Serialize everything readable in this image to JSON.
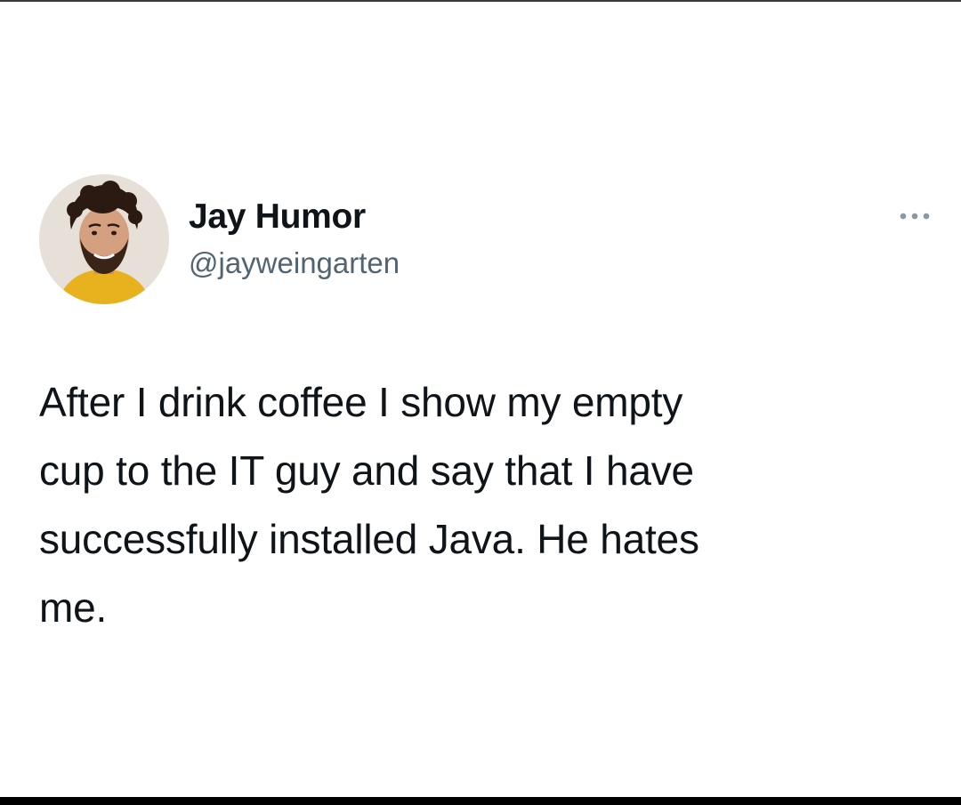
{
  "tweet": {
    "display_name": "Jay Humor",
    "handle": "@jayweingarten",
    "text": "After I drink coffee I show my empty\ncup to the IT guy and say that I have\nsuccessfully installed Java. He hates\nme.",
    "avatar_icon": "profile-photo",
    "more_icon": "ellipsis-icon"
  },
  "colors": {
    "background": "#ffffff",
    "text": "#0f1419",
    "secondary_text": "#536471"
  }
}
